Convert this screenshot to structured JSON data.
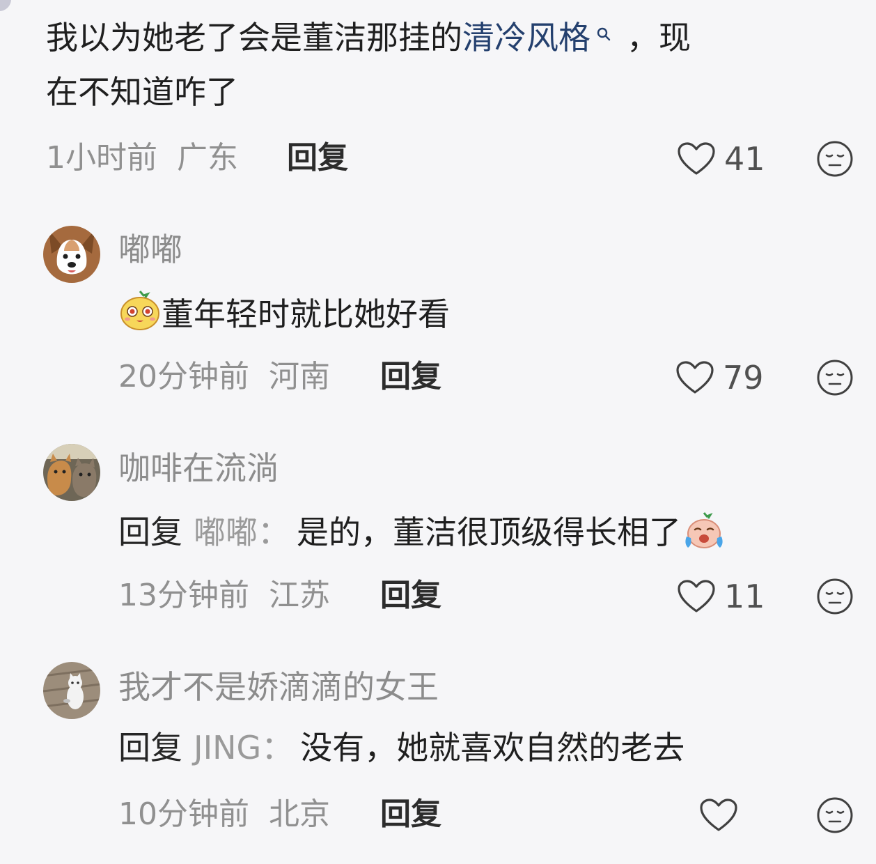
{
  "colors": {
    "background": "#f6f6f8",
    "link": "#24406e",
    "meta": "#909090",
    "username": "#8c8c8c"
  },
  "comments": [
    {
      "text_before": "我以为她老了会是董洁那挂的",
      "link_text": "清冷风格",
      "text_after": "，现",
      "text_line2": "在不知道咋了",
      "time": "1小时前",
      "location": "广东",
      "reply_label": "回复",
      "likes": "41",
      "icons": [
        "heart-outline-icon",
        "emoji-face-icon",
        "search-icon"
      ]
    },
    {
      "username": "嘟嘟",
      "text": "董年轻时就比她好看",
      "time": "20分钟前",
      "location": "河南",
      "reply_label": "回复",
      "likes": "79",
      "avatar": "corgi-dog-avatar",
      "icons": [
        "pear-face-sticker-icon"
      ]
    },
    {
      "username": "咖啡在流淌",
      "reply_prefix": "回复",
      "reply_to": "嘟嘟：",
      "text": "是的，董洁很顶级得长相了",
      "time": "13分钟前",
      "location": "江苏",
      "reply_label": "回复",
      "likes": "11",
      "avatar": "two-cats-avatar",
      "icons": [
        "crying-face-sticker-icon"
      ]
    },
    {
      "username": "我才不是娇滴滴的女王",
      "reply_prefix": "回复",
      "reply_to": "JING：",
      "text": "没有，她就喜欢自然的老去",
      "time": "10分钟前",
      "location": "北京",
      "reply_label": "回复",
      "likes": "",
      "avatar": "white-cat-avatar"
    }
  ]
}
